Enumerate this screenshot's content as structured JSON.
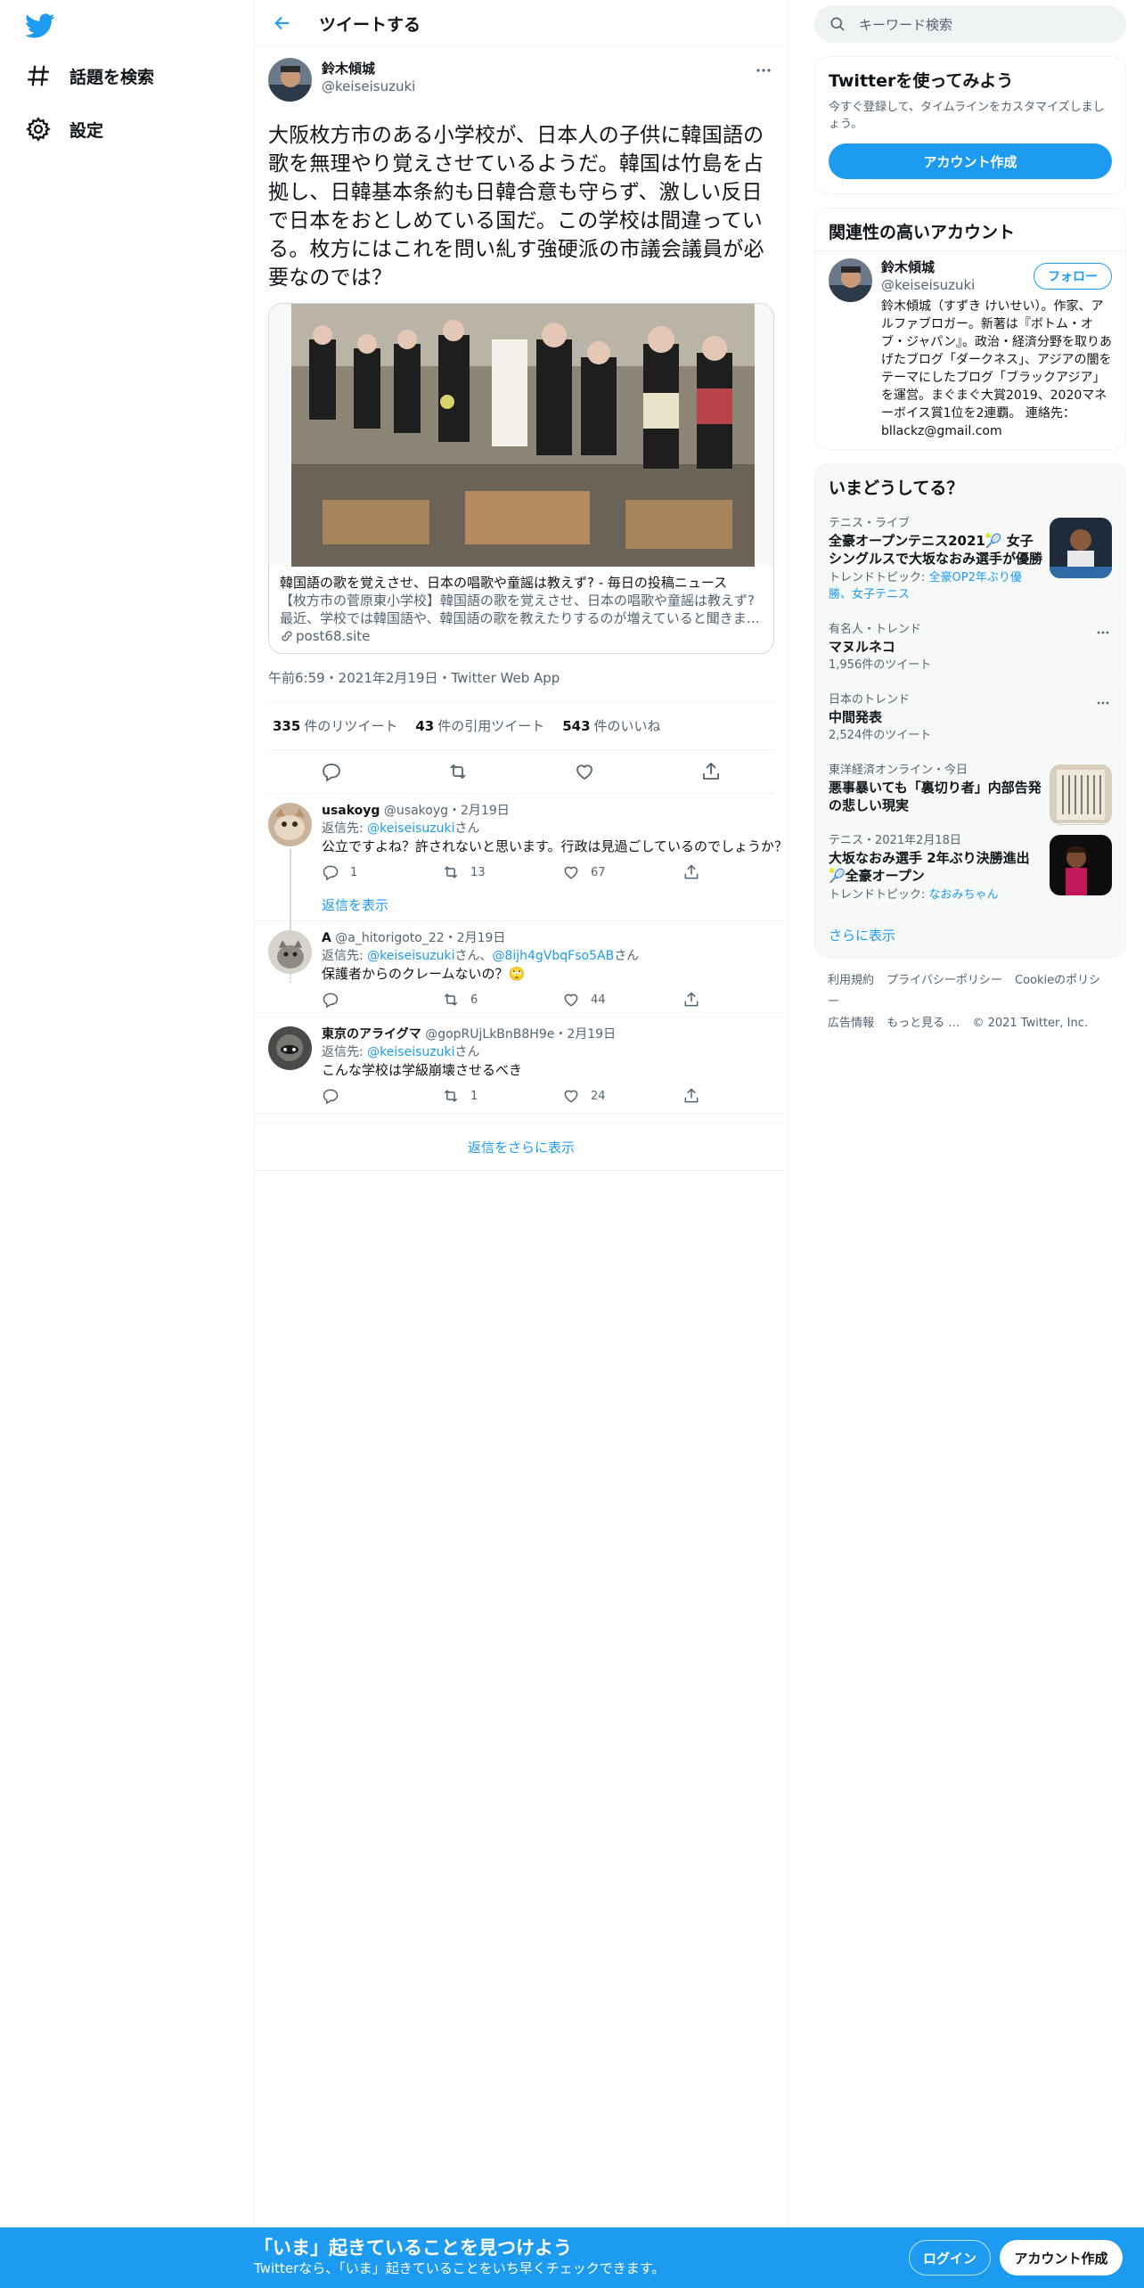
{
  "nav": {
    "logo_icon": "twitter-bird-icon",
    "items": [
      {
        "label": "話題を検索",
        "icon": "hashtag-icon"
      },
      {
        "label": "設定",
        "icon": "gear-icon"
      }
    ]
  },
  "header": {
    "title": "ツイートする",
    "back_icon": "arrow-left-icon"
  },
  "tweet": {
    "author_name": "鈴木傾城",
    "author_handle": "@keiseisuzuki",
    "text": "大阪枚方市のある小学校が、日本人の子供に韓国語の歌を無理やり覚えさせているようだ。韓国は竹島を占拠し、日韓基本条約も日韓合意も守らず、激しい反日で日本をおとしめている国だ。この学校は間違っている。枚方にはこれを問い糺す強硬派の市議会議員が必要なのでは？",
    "card": {
      "title": "韓国語の歌を覚えさせ、日本の唱歌や童謡は教えず? - 毎日の投稿ニュース",
      "description": "【枚方市の菅原東小学校】韓国語の歌を覚えさせ、日本の唱歌や童謡は教えず? 最近、学校では韓国語や、韓国語の歌を教えたりするのが増えていると聞きま…",
      "site": "post68.site"
    },
    "meta": "午前6:59・2021年2月19日・Twitter Web App",
    "stats": {
      "retweets": "335",
      "retweets_label": "件のリツイート",
      "quotes": "43",
      "quotes_label": "件の引用ツイート",
      "likes": "543",
      "likes_label": "件のいいね"
    }
  },
  "replies": [
    {
      "name": "usakoyg",
      "handle": "@usakoyg",
      "date": "・2月19日",
      "reply_to_label": "返信先: ",
      "mentions": "@keiseisuzuki",
      "suffix": "さん",
      "text": "公立ですよね？許されないと思います。行政は見過ごしているのでしょうか？",
      "replies": "1",
      "retweets": "13",
      "likes": "67",
      "show_replies": "返信を表示"
    },
    {
      "name": "A",
      "handle": "@a_hitorigoto_22",
      "date": "・2月19日",
      "reply_to_label": "返信先: ",
      "mentions": "@keiseisuzuki",
      "mid": "さん、",
      "mentions2": "@8ijh4gVbqFso5AB",
      "suffix": "さん",
      "text": "保護者からのクレームないの？🙄",
      "replies": "",
      "retweets": "6",
      "likes": "44"
    },
    {
      "name": "東京のアライグマ",
      "handle": "@gopRUjLkBnB8H9e",
      "date": "・2月19日",
      "reply_to_label": "返信先: ",
      "mentions": "@keiseisuzuki",
      "suffix": "さん",
      "text": "こんな学校は学級崩壊させるべき",
      "replies": "",
      "retweets": "1",
      "likes": "24"
    }
  ],
  "more_replies": "返信をさらに表示",
  "search": {
    "placeholder": "キーワード検索"
  },
  "signup_box": {
    "title": "Twitterを使ってみよう",
    "subtitle": "今すぐ登録して、タイムラインをカスタマイズしましょう。",
    "button": "アカウント作成"
  },
  "related": {
    "title": "関連性の高いアカウント",
    "name": "鈴木傾城",
    "handle": "@keiseisuzuki",
    "follow": "フォロー",
    "bio": "鈴木傾城（すずき けいせい）。作家、アルファブロガー。新著は『ボトム・オブ・ジャパン』。政治・経済分野を取りあげたブログ「ダークネス」、アジアの闇をテーマにしたブログ「ブラックアジア」を運営。まぐまぐ大賞2019、2020マネーボイス賞1位を2連覇。 連絡先：bllackz@gmail.com"
  },
  "trends": {
    "title": "いまどうしてる？",
    "items": [
      {
        "category": "テニス・ライブ",
        "name": "全豪オープンテニス2021🎾 女子シングルスで大坂なおみ選手が優勝",
        "topic_label": "トレンドトピック: ",
        "topic": "全豪OP2年ぶり優勝、女子テニス"
      },
      {
        "category": "有名人・トレンド",
        "name": "マヌルネコ",
        "count": "1,956件のツイート"
      },
      {
        "category": "日本のトレンド",
        "name": "中間発表",
        "count": "2,524件のツイート"
      },
      {
        "category": "東洋経済オンライン・今日",
        "name": "悪事暴いても「裏切り者」内部告発の悲しい現実"
      },
      {
        "category": "テニス・2021年2月18日",
        "name": "大坂なおみ選手 2年ぶり決勝進出🎾全豪オープン",
        "topic_label": "トレンドトピック: ",
        "topic": "なおみちゃん"
      }
    ],
    "show_more": "さらに表示"
  },
  "footer": {
    "links": [
      "利用規約",
      "プライバシーポリシー",
      "Cookieのポリシー",
      "広告情報",
      "もっと見る …",
      "© 2021 Twitter, Inc."
    ]
  },
  "bottom_bar": {
    "title": "「いま」起きていることを見つけよう",
    "subtitle": "Twitterなら、「いま」起きていることをいち早くチェックできます。",
    "login": "ログイン",
    "signup": "アカウント作成"
  },
  "colors": {
    "accent": "#1d9bf0",
    "text": "#0f1419",
    "muted": "#536471",
    "border": "#eff3f4"
  }
}
